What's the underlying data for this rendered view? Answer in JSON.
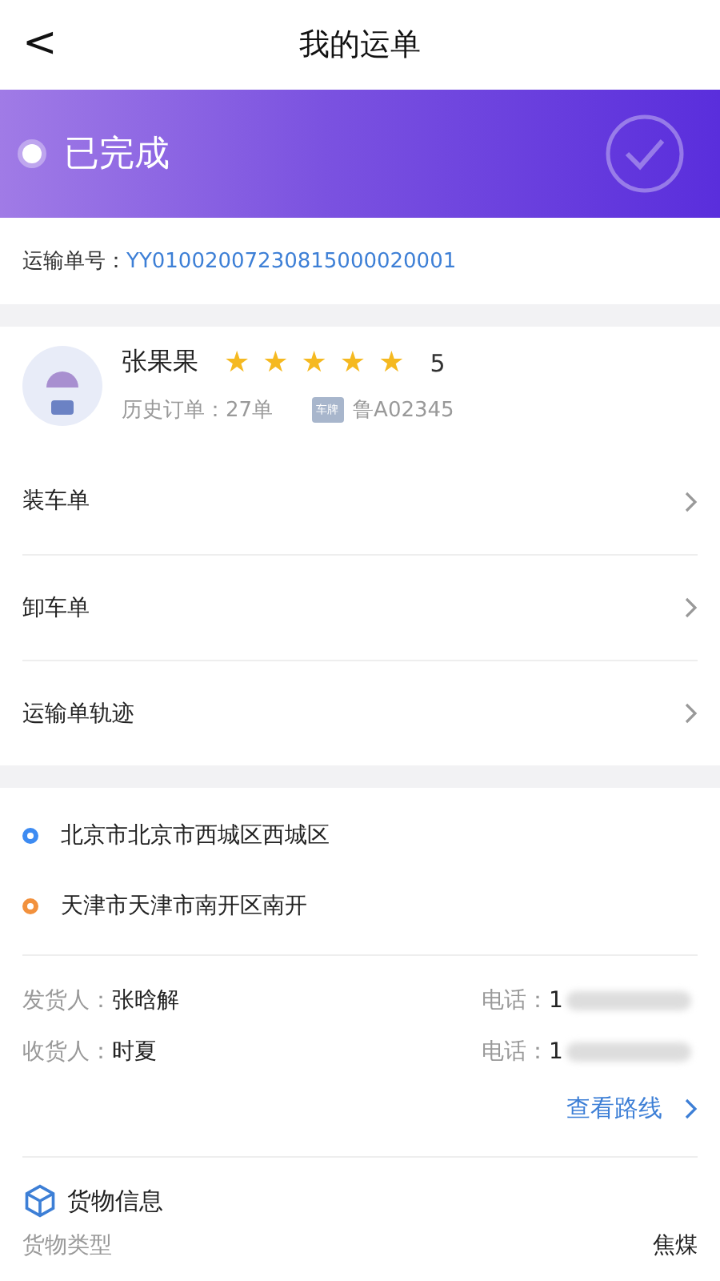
{
  "header": {
    "back": "<",
    "title": "我的运单"
  },
  "status": {
    "label": "已完成"
  },
  "order": {
    "label": "运输单号：",
    "number": "YY01002007230815000020001"
  },
  "driver": {
    "name": "张果果",
    "stars": 5,
    "rating": "5",
    "history": "历史订单：27单",
    "plate_tag": "车牌",
    "plate": "鲁A02345"
  },
  "links": [
    {
      "label": "装车单"
    },
    {
      "label": "卸车单"
    },
    {
      "label": "运输单轨迹"
    }
  ],
  "addresses": [
    {
      "text": "北京市北京市西城区西城区",
      "color": "#3d8bf2"
    },
    {
      "text": "天津市天津市南开区南开",
      "color": "#f2913d"
    }
  ],
  "parties": [
    {
      "role": "发货人：",
      "name": "张晗解",
      "phone_label": "电话：",
      "phone": "1"
    },
    {
      "role": "收货人：",
      "name": "时夏",
      "phone_label": "电话：",
      "phone": "1"
    }
  ],
  "route_link": "查看路线",
  "cargo": {
    "title": "货物信息",
    "rows": [
      {
        "label": "货物类型",
        "value": "焦煤"
      }
    ]
  }
}
